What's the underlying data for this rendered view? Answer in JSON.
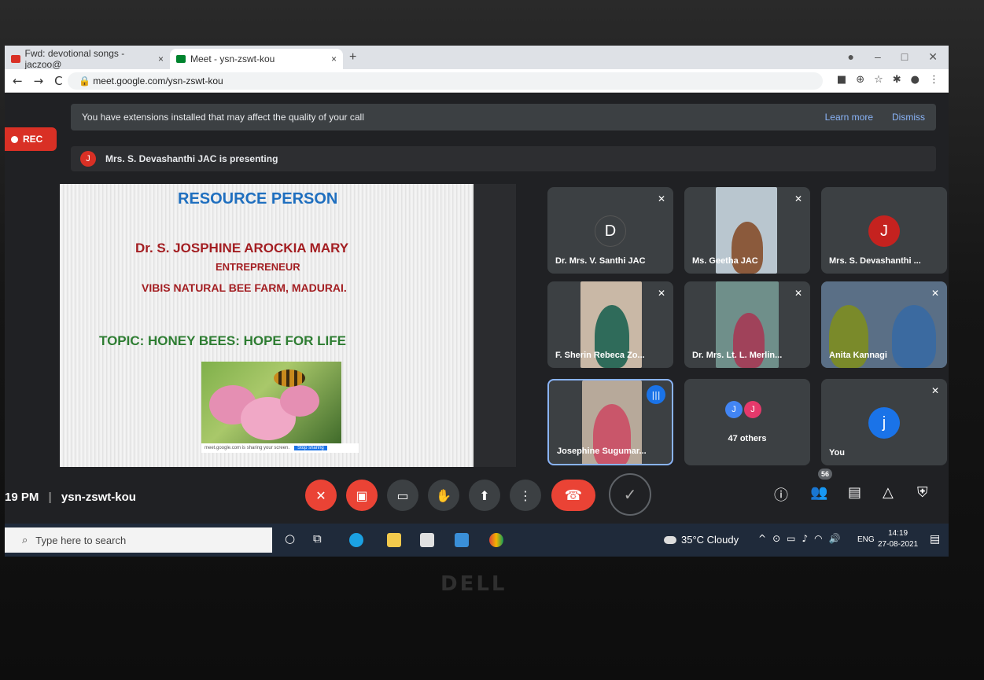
{
  "browser": {
    "tabs": [
      {
        "label": "Fwd: devotional songs - jaczoo@",
        "close": "×"
      },
      {
        "label": "Meet - ysn-zswt-kou",
        "close": "×"
      }
    ],
    "new_tab": "+",
    "url": "meet.google.com/ysn-zswt-kou"
  },
  "banner": {
    "message": "You have extensions installed that may affect the quality of your call",
    "learn_more": "Learn more",
    "dismiss": "Dismiss"
  },
  "rec": {
    "label": "REC"
  },
  "presenter": {
    "avatar": "J",
    "text": "Mrs. S. Devashanthi JAC is presenting"
  },
  "slide": {
    "title": "RESOURCE PERSON",
    "name": "Dr. S. JOSPHINE AROCKIA MARY",
    "role": "ENTREPRENEUR",
    "org": "VIBIS NATURAL BEE FARM, MADURAI.",
    "topic": "TOPIC: HONEY BEES: HOPE FOR LIFE",
    "share_msg": "meet.google.com is sharing your screen.",
    "stop_sharing": "Stop sharing"
  },
  "participants": [
    {
      "name": "Dr. Mrs. V. Santhi JAC",
      "initial": "D"
    },
    {
      "name": "Ms. Geetha JAC"
    },
    {
      "name": "Mrs. S. Devashanthi ...",
      "initial": "J"
    },
    {
      "name": "F. Sherin Rebeca Zo..."
    },
    {
      "name": "Dr. Mrs. Lt. L. Merlin..."
    },
    {
      "name": "Anita Kannagi"
    },
    {
      "name": "Josephine Sugumar..."
    },
    {
      "name": "47 others",
      "avatars": [
        "J",
        "J"
      ]
    },
    {
      "name": "You",
      "initial": "j"
    }
  ],
  "meeting": {
    "time": "19 PM",
    "code": "ysn-zswt-kou",
    "participant_count": "56"
  },
  "taskbar": {
    "search_placeholder": "Type here to search",
    "weather": "35°C  Cloudy",
    "lang": "ENG",
    "time": "14:19",
    "date": "27-08-2021"
  },
  "brand": "DELL",
  "colors": {
    "meet_red": "#ea4335",
    "meet_blue": "#1a73e8",
    "meet_dark": "#202124"
  }
}
